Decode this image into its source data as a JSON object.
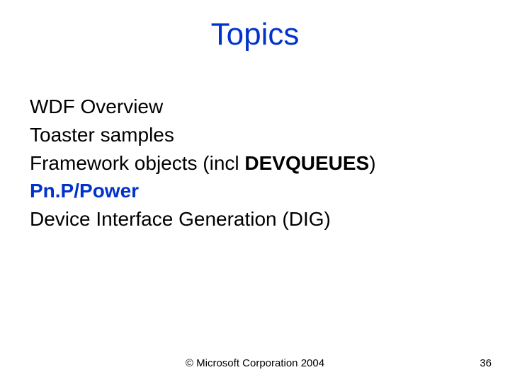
{
  "title": "Topics",
  "items": {
    "i0": "WDF Overview",
    "i1": "Toaster samples",
    "i2a": "Framework objects (incl ",
    "i2b": "DEVQUEUES",
    "i2c": ")",
    "i3": "Pn.P/Power",
    "i4": "Device Interface Generation (DIG)"
  },
  "footer": {
    "copyright": "© Microsoft Corporation 2004",
    "page": "36"
  }
}
